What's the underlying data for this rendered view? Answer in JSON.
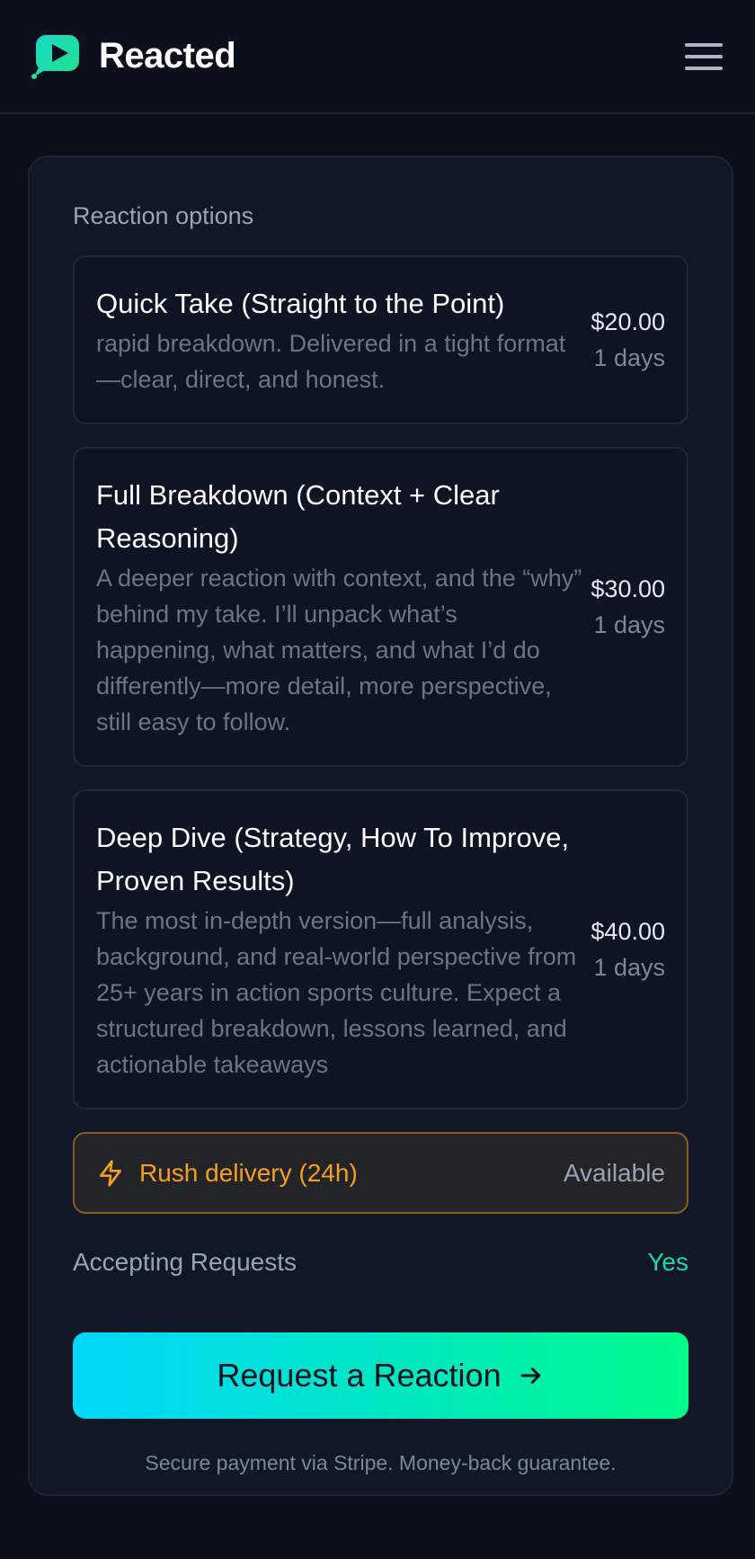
{
  "header": {
    "brand_name": "Reacted",
    "logo_icon": "play-bubble-icon",
    "menu_icon": "hamburger-menu-icon"
  },
  "options_section": {
    "title": "Reaction options",
    "options": [
      {
        "title": "Quick Take (Straight to the Point)",
        "description": "rapid breakdown. Delivered in a tight format—clear, direct, and honest.",
        "price": "$20.00",
        "delivery": "1 days"
      },
      {
        "title": "Full Breakdown (Context + Clear Reasoning)",
        "description": "A deeper reaction with context, and the “why” behind my take. I’ll unpack what’s happening, what matters, and what I’d do differently—more detail, more perspective, still easy to follow.",
        "price": "$30.00",
        "delivery": "1 days"
      },
      {
        "title": "Deep Dive (Strategy, How To Improve, Proven Results)",
        "description": "The most in-depth version—full analysis, background, and real-world perspective from 25+ years in action sports culture. Expect a structured breakdown, lessons learned, and actionable takeaways",
        "price": "$40.00",
        "delivery": "1 days"
      }
    ]
  },
  "rush": {
    "label": "Rush delivery (24h)",
    "status": "Available",
    "icon": "lightning-bolt-icon"
  },
  "accepting": {
    "label": "Accepting Requests",
    "value": "Yes"
  },
  "cta": {
    "label": "Request a Reaction",
    "icon": "arrow-right-icon"
  },
  "footnote": "Secure payment via Stripe. Money-back guarantee.",
  "colors": {
    "background": "#0a0f1a",
    "card": "#101828",
    "accent_start": "#00d7fb",
    "accent_end": "#00fb8a",
    "rush_orange": "#f59f1f",
    "yes_green": "#19d9a3"
  }
}
